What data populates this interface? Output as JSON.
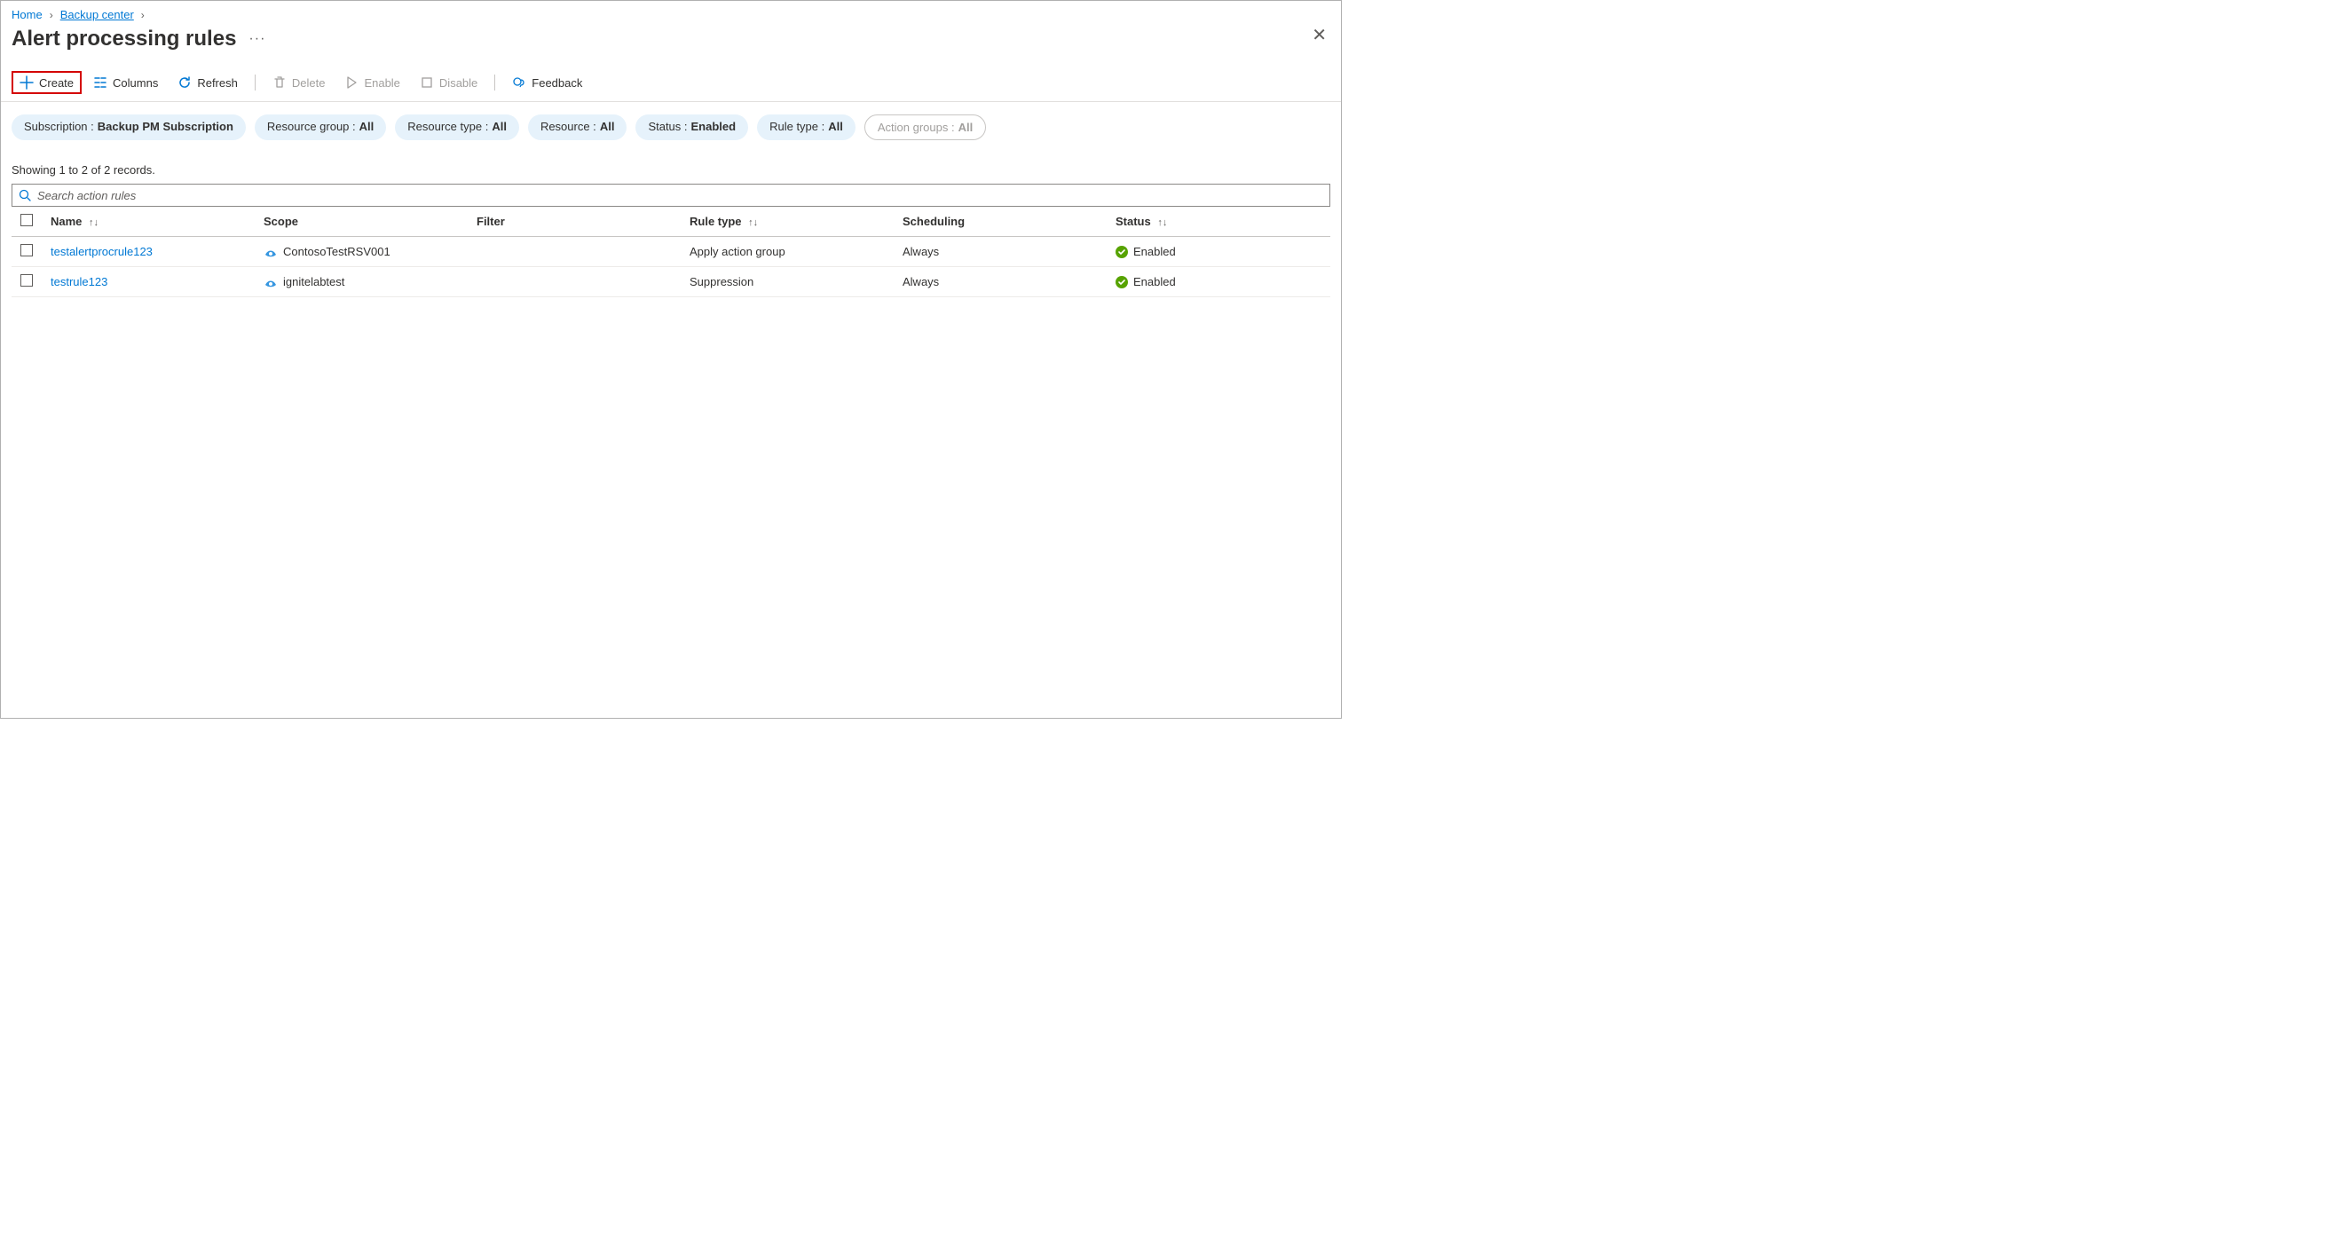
{
  "breadcrumb": {
    "home": "Home",
    "backup_center": "Backup center"
  },
  "page": {
    "title": "Alert processing rules"
  },
  "toolbar": {
    "create": "Create",
    "columns": "Columns",
    "refresh": "Refresh",
    "delete": "Delete",
    "enable": "Enable",
    "disable": "Disable",
    "feedback": "Feedback"
  },
  "filters": {
    "subscription": {
      "label": "Subscription :",
      "value": "Backup PM Subscription"
    },
    "resource_group": {
      "label": "Resource group :",
      "value": "All"
    },
    "resource_type": {
      "label": "Resource type :",
      "value": "All"
    },
    "resource": {
      "label": "Resource :",
      "value": "All"
    },
    "status": {
      "label": "Status :",
      "value": "Enabled"
    },
    "rule_type": {
      "label": "Rule type :",
      "value": "All"
    },
    "action_groups": {
      "label": "Action groups :",
      "value": "All"
    }
  },
  "records_summary": "Showing 1 to 2 of 2 records.",
  "search": {
    "placeholder": "Search action rules"
  },
  "table": {
    "headers": {
      "name": "Name",
      "scope": "Scope",
      "filter": "Filter",
      "rule_type": "Rule type",
      "scheduling": "Scheduling",
      "status": "Status"
    },
    "rows": [
      {
        "name": "testalertprocrule123",
        "scope": "ContosoTestRSV001",
        "filter": "",
        "rule_type": "Apply action group",
        "scheduling": "Always",
        "status": "Enabled"
      },
      {
        "name": "testrule123",
        "scope": "ignitelabtest",
        "filter": "",
        "rule_type": "Suppression",
        "scheduling": "Always",
        "status": "Enabled"
      }
    ]
  }
}
